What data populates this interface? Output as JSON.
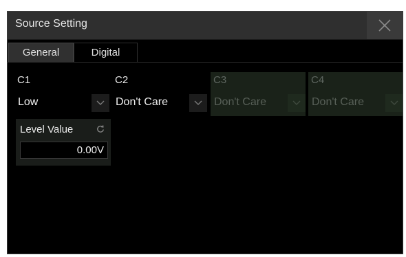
{
  "dialog": {
    "title": "Source Setting",
    "close_icon": "close-icon"
  },
  "tabs": [
    {
      "label": "General",
      "active": true
    },
    {
      "label": "Digital",
      "active": false
    }
  ],
  "channels": [
    {
      "label": "C1",
      "value": "Low",
      "enabled": true
    },
    {
      "label": "C2",
      "value": "Don't Care",
      "enabled": true
    },
    {
      "label": "C3",
      "value": "Don't Care",
      "enabled": false
    },
    {
      "label": "C4",
      "value": "Don't Care",
      "enabled": false
    }
  ],
  "level": {
    "label": "Level Value",
    "value": "0.00V",
    "icon": "refresh-icon"
  },
  "colors": {
    "background": "#000000",
    "titlebar": "#2f2f2f",
    "disabled_panel": "#1a2219",
    "text": "#e8e8e8",
    "disabled_text": "#5e6660"
  }
}
